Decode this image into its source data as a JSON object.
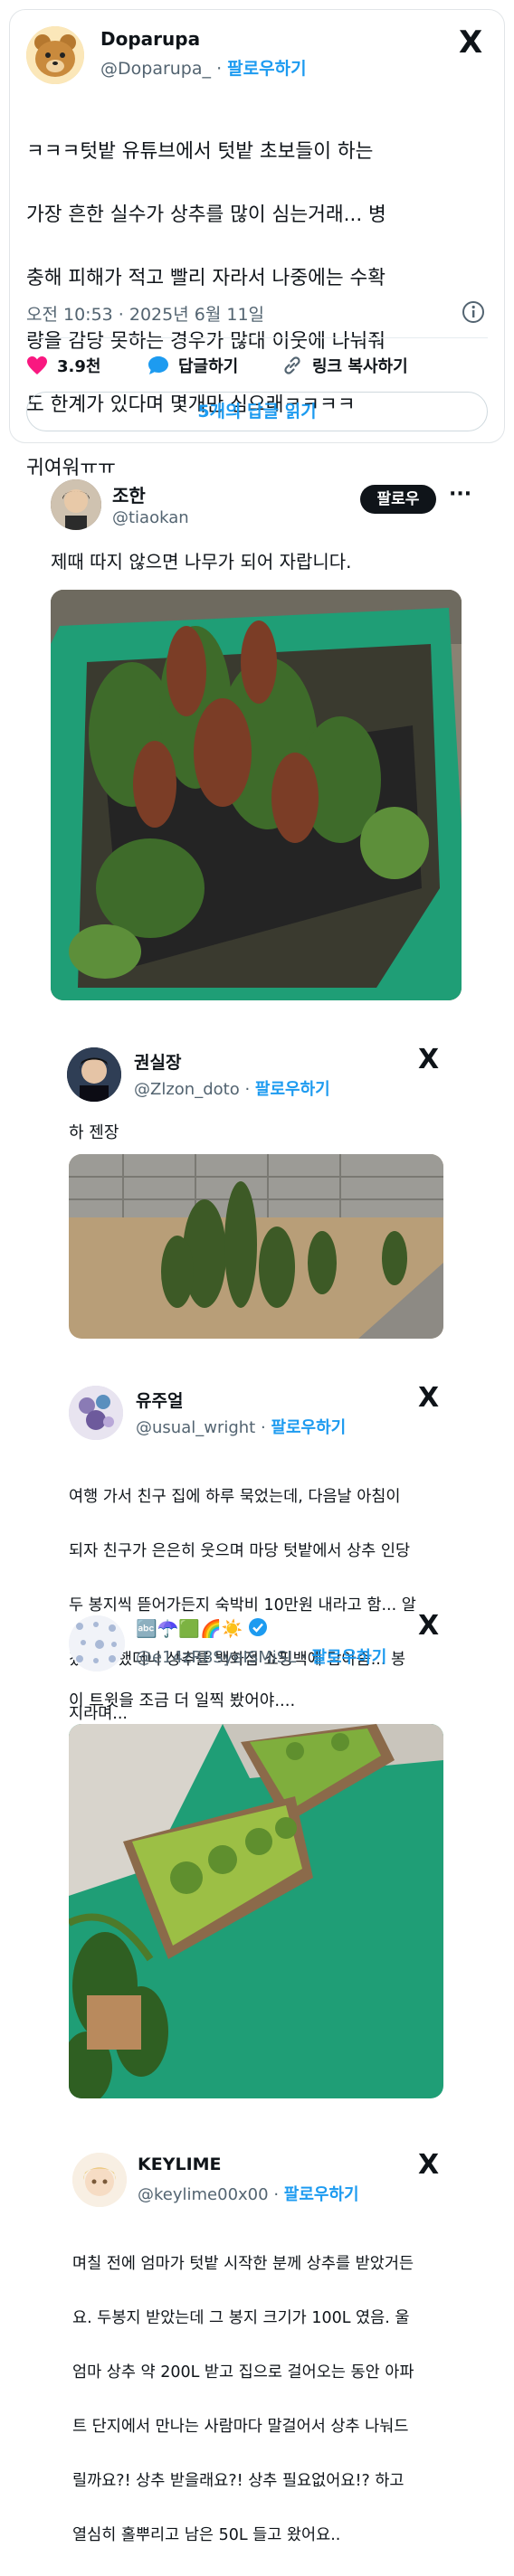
{
  "main_tweet": {
    "name": "Doparupa",
    "handle": "@Doparupa_",
    "follow_label": "팔로우하기",
    "text": "ㅋㅋㅋ텃밭 유튜브에서 텃밭 초보들이 하는 가장 흔한 실수가 상추를 많이 심는거래... 병충해 피해가 적고 빨리 자라서 나중에는 수확량을 감당 못하는 경우가 많대 이웃에 나눠줘도 한계가 있다며 몇개만 심으래ㅋㅋㅋㅋ 귀여워ㅠㅠ",
    "text_lines": [
      "ㅋㅋㅋ텃밭 유튜브에서 텃밭 초보들이 하는",
      "가장 흔한 실수가 상추를 많이 심는거래... 병",
      "충해 피해가 적고 빨리 자라서 나중에는 수확",
      "량을 감당 못하는 경우가 많대 이웃에 나눠줘",
      "도 한계가 있다며 몇개만 심으래ㅋㅋㅋㅋ",
      "귀여워ㅠㅠ"
    ],
    "timestamp": "오전 10:53 · 2025년 6월 11일",
    "likes": "3.9천",
    "reply_label": "답글하기",
    "copy_link_label": "링크 복사하기",
    "read_replies_label": "5개의 답글 읽기"
  },
  "reply_1": {
    "name": "조한",
    "handle": "@tiaokan",
    "follow_label": "팔로우",
    "more": "···",
    "text": "제때 따지 않으면 나무가 되어 자랍니다."
  },
  "quote_1": {
    "name": "권실장",
    "handle": "@Zlzon_doto",
    "follow_label": "팔로우하기",
    "text": "하 젠장"
  },
  "quote_2": {
    "name": "유주얼",
    "handle": "@usual_wright",
    "follow_label": "팔로우하기",
    "text_lines": [
      "여행 가서 친구 집에 하루 묵었는데, 다음날 아침이",
      "되자 친구가 은은히 웃으며 마당 텃밭에서 상추 인당",
      "두 봉지씩 뜯어가든지 숙박비 10만원 내라고 함... 알",
      "겠다고 했더니 상추를 백화점 쇼핑백에 담아줌... 봉",
      "지라며..."
    ]
  },
  "quote_3": {
    "name_emojis": "🔤☂️🟩🌈☀️",
    "handle": "@e14zR8SyeISMiSL",
    "follow_label": "팔로우하기",
    "text": "이 트윗을 조금 더 일찍 봤어야...."
  },
  "quote_4": {
    "name": "KEYLIME",
    "handle": "@keylime00x00",
    "follow_label": "팔로우하기",
    "text_lines": [
      "며칠 전에 엄마가 텃밭 시작한 분께 상추를 받았거든",
      "요. 두봉지 받았는데 그 봉지 크기가 100L 였음. 울",
      "엄마 상추 약 200L 받고 집으로 걸어오는 동안 아파",
      "트 단지에서 만나는 사람마다 말걸어서 상추 나눠드",
      "릴까요?! 상추 받을래요?! 상추 필요없어요!? 하고",
      "열심히 홀뿌리고 남은 50L 들고 왔어요.."
    ]
  },
  "colors": {
    "accent": "#1d9bf0",
    "like": "#f91880",
    "secondary_text": "#536471",
    "planter_green": "#1f9e76"
  },
  "icons": {
    "x_logo": "X",
    "heart": "heart-icon",
    "reply": "speech-bubble-icon",
    "link": "link-icon",
    "info": "info-icon",
    "verified": "verified-badge-icon"
  }
}
